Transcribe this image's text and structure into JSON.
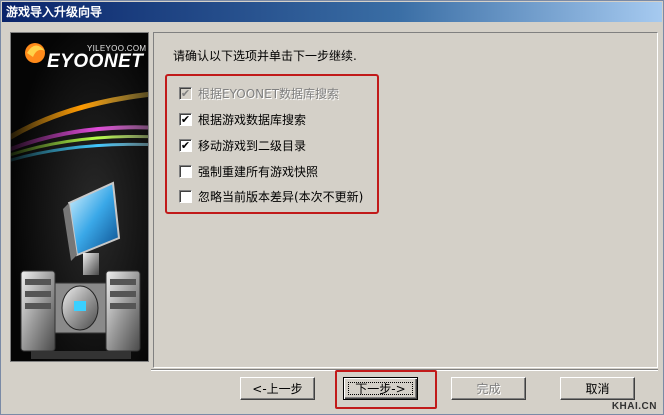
{
  "window": {
    "title": "游戏导入升级向导"
  },
  "brand": {
    "site": "YILEYOO.COM",
    "logo": "EYOONET"
  },
  "content": {
    "instruction": "请确认以下选项并单击下一步继续."
  },
  "options": [
    {
      "label": "根据EYOONET数据库搜索",
      "checked": true,
      "disabled": true
    },
    {
      "label": "根据游戏数据库搜索",
      "checked": true,
      "disabled": false
    },
    {
      "label": "移动游戏到二级目录",
      "checked": true,
      "disabled": false
    },
    {
      "label": "强制重建所有游戏快照",
      "checked": false,
      "disabled": false
    },
    {
      "label": "忽略当前版本差异(本次不更新)",
      "checked": false,
      "disabled": false
    }
  ],
  "buttons": {
    "back": "<-上一步",
    "next": "下一步->",
    "finish": "完成",
    "cancel": "取消"
  },
  "watermark": "KHAI.CN",
  "colors": {
    "highlight": "#c11a1a",
    "dialog_bg": "#d4d0c8",
    "titlebar": "#0a246a"
  }
}
